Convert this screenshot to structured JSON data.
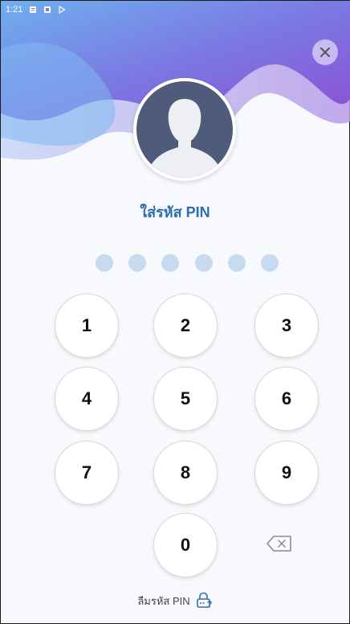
{
  "status_bar": {
    "time": "1:21"
  },
  "title": "ใส่รหัส PIN",
  "pin_length": 6,
  "pin_entered": 0,
  "keypad": [
    "1",
    "2",
    "3",
    "4",
    "5",
    "6",
    "7",
    "8",
    "9",
    "0"
  ],
  "forgot_label": "ลืมรหัส PIN",
  "icons": {
    "close": "close-icon",
    "backspace": "backspace-icon",
    "forgot": "lock-help-icon",
    "avatar": "user-silhouette-icon"
  },
  "colors": {
    "accent": "#2c6fb0",
    "dot_empty": "#c6daf0",
    "avatar_bg": "#4f5b7a",
    "wave_purple": "#8a5cd8",
    "wave_blue": "#6fb0f0"
  }
}
